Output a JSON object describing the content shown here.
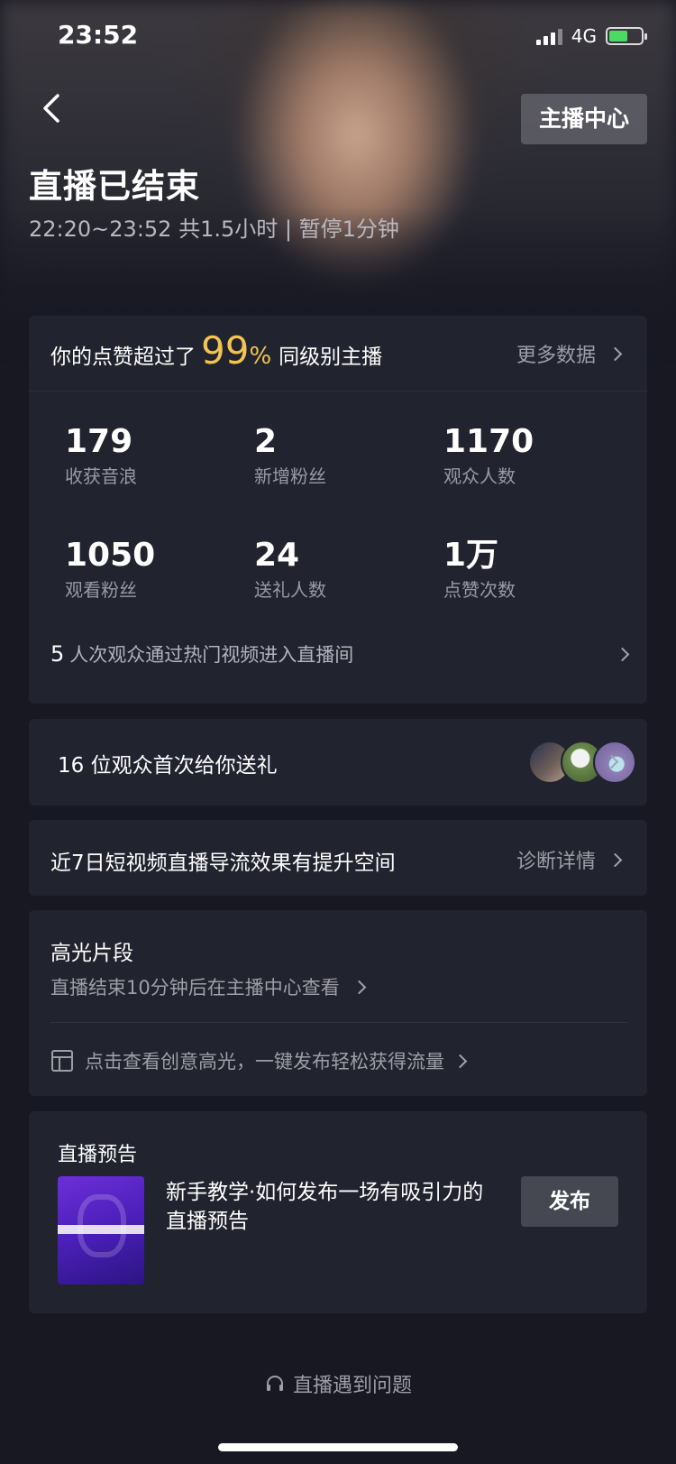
{
  "status_bar": {
    "time": "23:52",
    "network": "4G"
  },
  "header": {
    "anchor_center_label": "主播中心",
    "title": "直播已结束",
    "subtitle": "22:20~23:52 共1.5小时 | 暂停1分钟"
  },
  "stats": {
    "beat_prefix": "你的点赞超过了",
    "beat_percent": "99",
    "beat_percent_sign": "%",
    "beat_suffix": "同级别主播",
    "more_data": "更多数据",
    "items": [
      {
        "value": "179",
        "label": "收获音浪"
      },
      {
        "value": "2",
        "label": "新增粉丝"
      },
      {
        "value": "1170",
        "label": "观众人数"
      },
      {
        "value": "1050",
        "label": "观看粉丝"
      },
      {
        "value": "24",
        "label": "送礼人数"
      },
      {
        "value": "1万",
        "label": "点赞次数"
      }
    ],
    "hot_count": "5",
    "hot_text": "人次观众通过热门视频进入直播间"
  },
  "gift": {
    "text": "16 位观众首次给你送礼"
  },
  "diagnose": {
    "text": "近7日短视频直播导流效果有提升空间",
    "link": "诊断详情"
  },
  "highlight": {
    "title": "高光片段",
    "subtitle": "直播结束10分钟后在主播中心查看",
    "creative": "点击查看创意高光，一键发布轻松获得流量"
  },
  "preview": {
    "title": "直播预告",
    "description": "新手教学·如何发布一场有吸引力的直播预告",
    "publish_label": "发布"
  },
  "help": {
    "label": "直播遇到问题"
  },
  "colors": {
    "accent_gold": "#f3c453",
    "background": "#171822",
    "card": "#21232e"
  }
}
